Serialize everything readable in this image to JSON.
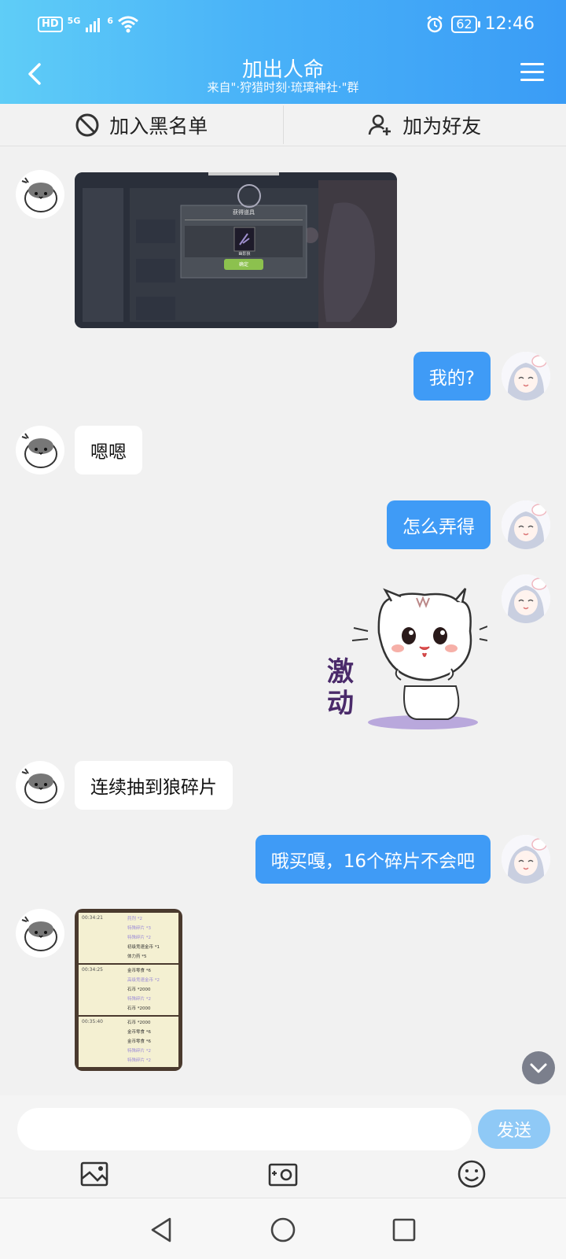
{
  "status_bar": {
    "hd": "HD",
    "net1": "5G",
    "net2": "6",
    "battery": "62",
    "time": "12:46"
  },
  "header": {
    "title": "加出人命",
    "subtitle": "来自\"·狩猎时刻·琉璃神社·\"群"
  },
  "actions": {
    "block_label": "加入黑名单",
    "add_friend_label": "加为好友"
  },
  "messages": [
    {
      "side": "in",
      "type": "image",
      "content": "game screenshot: 获得道具"
    },
    {
      "side": "out",
      "type": "text",
      "text": "我的?"
    },
    {
      "side": "in",
      "type": "text",
      "text": "嗯嗯"
    },
    {
      "side": "out",
      "type": "text",
      "text": "怎么弄得"
    },
    {
      "side": "out",
      "type": "sticker",
      "text": "激动"
    },
    {
      "side": "in",
      "type": "text",
      "text": "连续抽到狼碎片"
    },
    {
      "side": "out",
      "type": "text",
      "text": "哦买嘎，16个碎片不会吧"
    },
    {
      "side": "in",
      "type": "image",
      "content": "draw record screenshot"
    }
  ],
  "image_msg_1": {
    "dialog_title": "获得道具",
    "item_name": "幽影狼",
    "confirm": "确定"
  },
  "image_msg_2": {
    "entries": [
      {
        "time": "00:34:21",
        "lines": [
          "药剂 *2",
          "特殊碎片 *3",
          "特殊碎片 *2",
          "初级竞速金币 *1",
          "体力药 *5"
        ]
      },
      {
        "time": "00:34:25",
        "lines": [
          "金币零食 *6",
          "高级竞速金币 *2",
          "石币 *2000",
          "特殊碎片 *2",
          "石币 *2000"
        ]
      },
      {
        "time": "00:35:40",
        "lines": [
          "石币 *2000",
          "金币零食 *6",
          "金币零食 *6",
          "特殊碎片 *2",
          "特殊碎片 *2"
        ]
      }
    ]
  },
  "input": {
    "placeholder": "",
    "send_label": "发送"
  },
  "colors": {
    "header_start": "#5fcdf7",
    "header_end": "#3a9cf6",
    "out_bubble": "#3f9bf6",
    "send_button": "#8fc9f6"
  }
}
